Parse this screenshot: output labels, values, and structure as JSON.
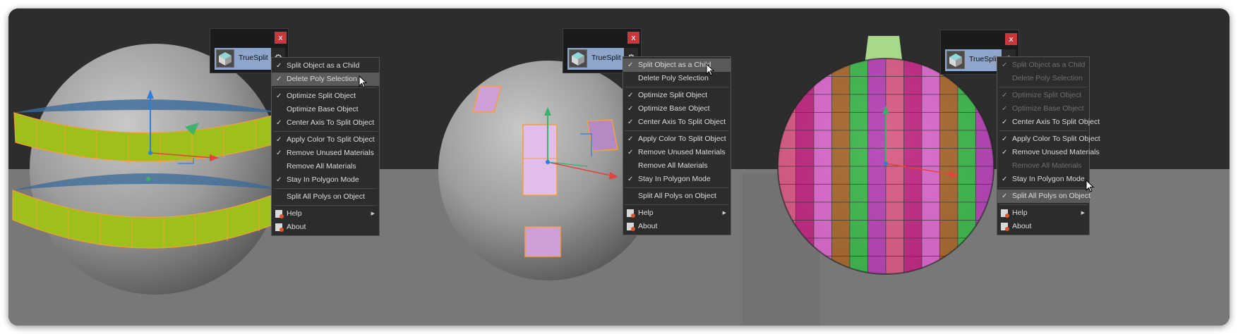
{
  "panels": [
    {
      "plugin_name": "TrueSplit",
      "close_label": "x",
      "items": [
        {
          "label": "Split Object as a Child",
          "checked": true,
          "state": "normal"
        },
        {
          "label": "Delete Poly Selection",
          "checked": true,
          "state": "highlight"
        },
        {
          "sep": true
        },
        {
          "label": "Optimize Split Object",
          "checked": true,
          "state": "normal"
        },
        {
          "label": "Optimize Base Object",
          "checked": false,
          "state": "normal"
        },
        {
          "label": "Center Axis To Split Object",
          "checked": true,
          "state": "normal"
        },
        {
          "sep": true
        },
        {
          "label": "Apply Color To Split Object",
          "checked": true,
          "state": "normal"
        },
        {
          "label": "Remove Unused Materials",
          "checked": true,
          "state": "normal"
        },
        {
          "label": "Remove All Materials",
          "checked": false,
          "state": "normal"
        },
        {
          "label": "Stay In Polygon Mode",
          "checked": true,
          "state": "normal"
        },
        {
          "sep": true
        },
        {
          "label": "Split All Polys on Object",
          "checked": false,
          "state": "normal"
        },
        {
          "sep": true
        },
        {
          "label": "Help",
          "icon": "plugin-icon",
          "submenu": true,
          "state": "normal"
        },
        {
          "label": "About",
          "icon": "plugin-icon",
          "state": "normal"
        }
      ]
    },
    {
      "plugin_name": "TrueSplit",
      "close_label": "x",
      "items": [
        {
          "label": "Split Object as a Child",
          "checked": true,
          "state": "highlight"
        },
        {
          "label": "Delete Poly Selection",
          "checked": false,
          "state": "normal"
        },
        {
          "sep": true
        },
        {
          "label": "Optimize Split Object",
          "checked": true,
          "state": "normal"
        },
        {
          "label": "Optimize Base Object",
          "checked": true,
          "state": "normal"
        },
        {
          "label": "Center Axis To Split Object",
          "checked": true,
          "state": "normal"
        },
        {
          "sep": true
        },
        {
          "label": "Apply Color To Split Object",
          "checked": true,
          "state": "normal"
        },
        {
          "label": "Remove Unused Materials",
          "checked": true,
          "state": "normal"
        },
        {
          "label": "Remove All Materials",
          "checked": false,
          "state": "normal"
        },
        {
          "label": "Stay In Polygon Mode",
          "checked": true,
          "state": "normal"
        },
        {
          "sep": true
        },
        {
          "label": "Split All Polys on Object",
          "checked": false,
          "state": "normal"
        },
        {
          "sep": true
        },
        {
          "label": "Help",
          "icon": "plugin-icon",
          "submenu": true,
          "state": "normal"
        },
        {
          "label": "About",
          "icon": "plugin-icon",
          "state": "normal"
        }
      ]
    },
    {
      "plugin_name": "TrueSplit",
      "close_label": "x",
      "items": [
        {
          "label": "Split Object as a Child",
          "checked": true,
          "state": "disabled"
        },
        {
          "label": "Delete Poly Selection",
          "checked": false,
          "state": "disabled"
        },
        {
          "sep": true
        },
        {
          "label": "Optimize Split Object",
          "checked": true,
          "state": "disabled"
        },
        {
          "label": "Optimize Base Object",
          "checked": true,
          "state": "disabled"
        },
        {
          "label": "Center Axis To Split Object",
          "checked": true,
          "state": "normal"
        },
        {
          "sep": true
        },
        {
          "label": "Apply Color To Split Object",
          "checked": true,
          "state": "normal"
        },
        {
          "label": "Remove Unused Materials",
          "checked": true,
          "state": "normal"
        },
        {
          "label": "Remove All Materials",
          "checked": false,
          "state": "disabled"
        },
        {
          "label": "Stay In Polygon Mode",
          "checked": true,
          "state": "normal"
        },
        {
          "sep": true
        },
        {
          "label": "Split All Polys on Object",
          "checked": true,
          "state": "highlight"
        },
        {
          "sep": true
        },
        {
          "label": "Help",
          "icon": "plugin-icon",
          "submenu": true,
          "state": "normal"
        },
        {
          "label": "About",
          "icon": "plugin-icon",
          "state": "normal"
        }
      ]
    }
  ],
  "colors": {
    "viewport_bg": "#2d2d2d",
    "floor": "#787878",
    "band_green": "#9fbf1a",
    "selection_orange": "#f2a03a",
    "selected_poly": "#cfa0d8",
    "close_red": "#c8383a",
    "plugin_button": "#8ea6cc",
    "menu_bg": "#2c2c2c",
    "menu_highlight": "#5a5a5a",
    "axis_x": "#e0443c",
    "axis_y": "#33b466",
    "axis_z": "#2f7fd8"
  }
}
